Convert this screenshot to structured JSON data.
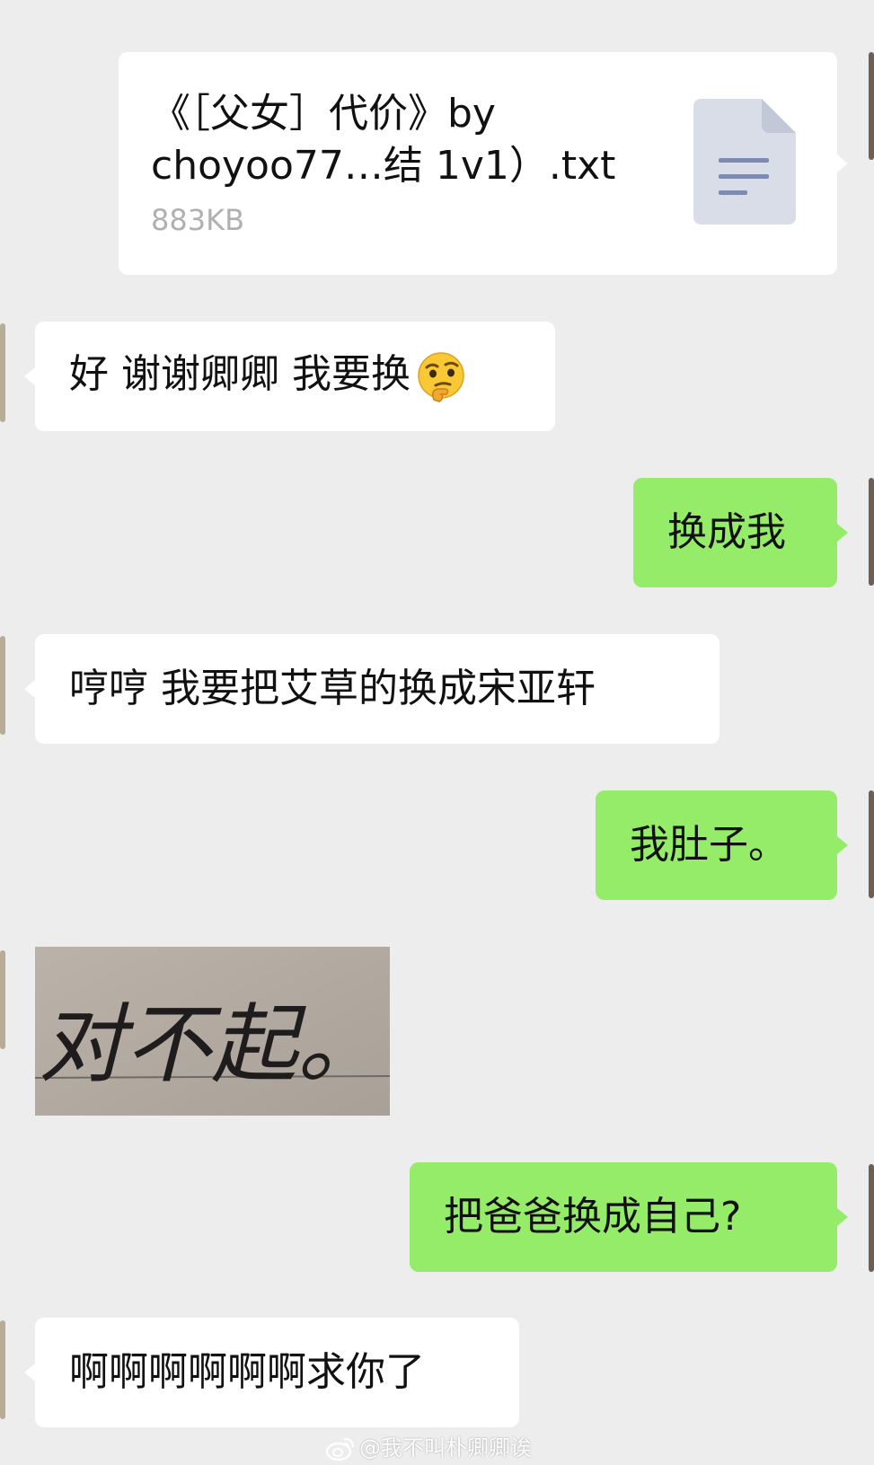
{
  "chat": {
    "file_message": {
      "title": "《［父女］代价》by choyoo77…结 1v1）.txt",
      "size": "883KB",
      "icon": "document-icon"
    },
    "messages": [
      {
        "side": "left",
        "text": "好 谢谢卿卿 我要换",
        "emoji": "thinking-face-emoji"
      },
      {
        "side": "right",
        "text": "换成我"
      },
      {
        "side": "left",
        "text": "哼哼 我要把艾草的换成宋亚轩"
      },
      {
        "side": "right",
        "text": "我肚子。"
      },
      {
        "side": "left",
        "image_text": "对不起。"
      },
      {
        "side": "right",
        "text": "把爸爸换成自己?"
      },
      {
        "side": "left",
        "text": "啊啊啊啊啊啊求你了"
      }
    ]
  },
  "watermark": {
    "text": "@我不叫朴卿卿诶",
    "icon": "weibo-logo-icon"
  },
  "colors": {
    "background": "#ededed",
    "incoming_bubble": "#ffffff",
    "outgoing_bubble": "#95ec69"
  }
}
